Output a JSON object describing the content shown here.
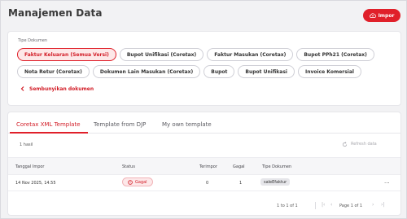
{
  "page": {
    "title": "Manajemen Data",
    "import_label": "Impor"
  },
  "document_filter": {
    "label": "Tipe Dokumen",
    "chips": [
      {
        "label": "Faktur Keluaran (Semua Versi)",
        "active": true
      },
      {
        "label": "Bupot Unifikasi (Coretax)",
        "active": false
      },
      {
        "label": "Faktur Masukan (Coretax)",
        "active": false
      },
      {
        "label": "Bupot PPh21 (Coretax)",
        "active": false
      },
      {
        "label": "Nota Retur (Coretax)",
        "active": false
      },
      {
        "label": "Dokumen Lain Masukan (Coretax)",
        "active": false
      },
      {
        "label": "Bupot",
        "active": false
      },
      {
        "label": "Bupot Unifikasi",
        "active": false
      },
      {
        "label": "Invoice Komersial",
        "active": false
      }
    ],
    "hide_link": "Sembunyikan dokumen"
  },
  "tabs": [
    {
      "label": "Coretax XML Template",
      "active": true
    },
    {
      "label": "Template from DJP",
      "active": false
    },
    {
      "label": "My own template",
      "active": false
    }
  ],
  "results": {
    "count_label": "1 hasil",
    "refresh_label": "Refresh data"
  },
  "table": {
    "columns": [
      "Tanggal Impor",
      "Status",
      "Terimpor",
      "Gagal",
      "Tipe Dokumen"
    ],
    "rows": [
      {
        "tanggal": "14 Nov 2025, 14.55",
        "status": "Gagal",
        "terimpor": "0",
        "gagal": "1",
        "tipe": "saleEfaktur",
        "more": "..."
      }
    ]
  },
  "pagination": {
    "range": "1 to 1 of 1",
    "page": "Page 1 of 1"
  },
  "colors": {
    "accent": "#e0202a",
    "accent_bg": "#fde8e8"
  },
  "icons": {
    "import": "cloud-upload-icon",
    "hide": "chevron-left-icon",
    "refresh": "refresh-icon",
    "status": "error-circle-icon",
    "first": "first-page-icon",
    "prev": "prev-page-icon",
    "next": "next-page-icon",
    "last": "last-page-icon"
  }
}
